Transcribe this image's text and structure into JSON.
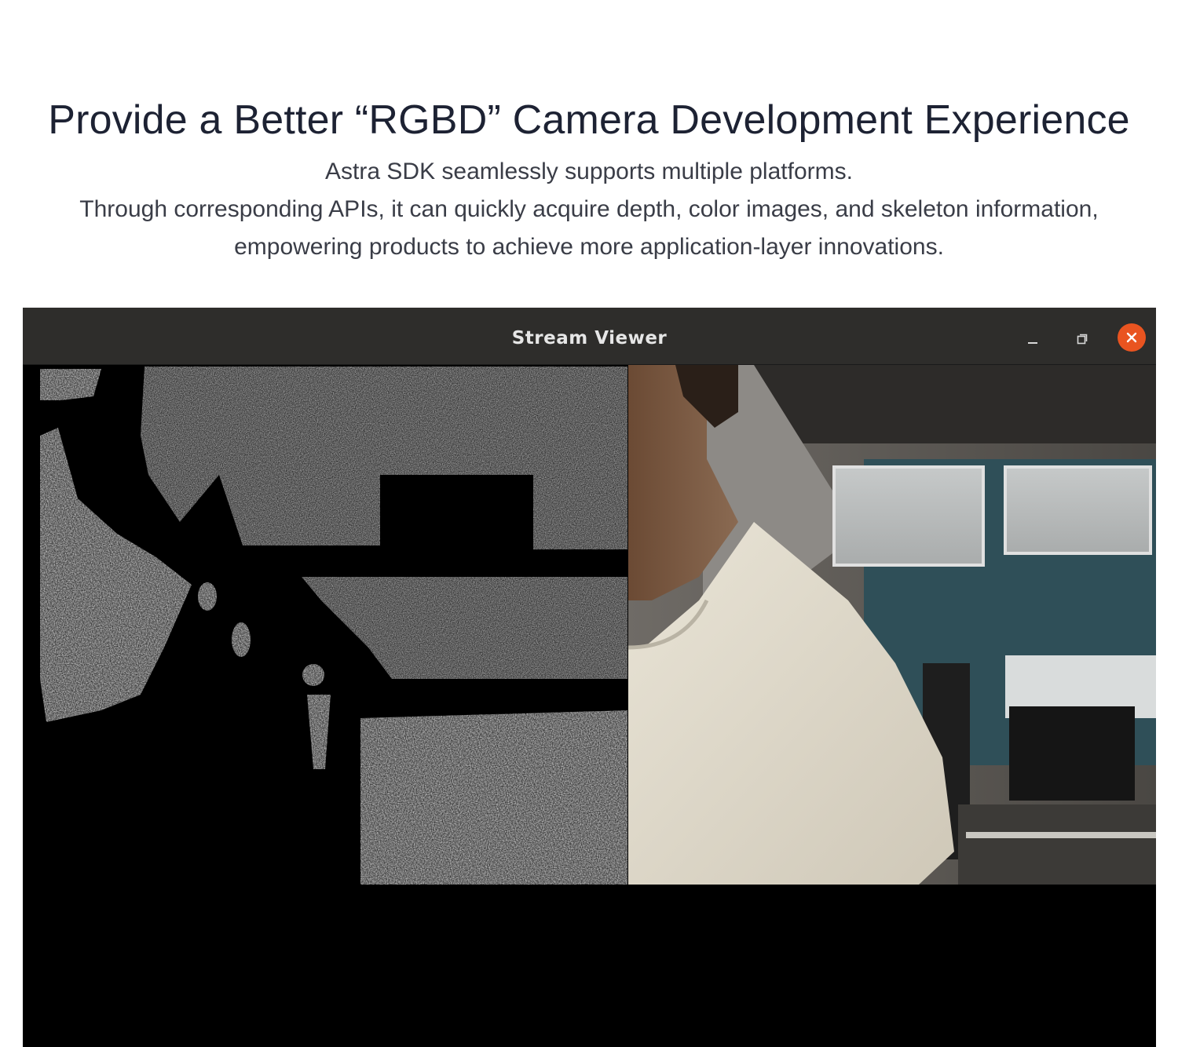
{
  "hero": {
    "headline": "Provide a Better “RGBD” Camera Development Experience",
    "line1": "Astra SDK seamlessly supports multiple platforms.",
    "line2": "Through corresponding APIs, it can quickly acquire depth, color images, and skeleton information,",
    "line3": "empowering products to achieve more application-layer innovations."
  },
  "window": {
    "title": "Stream Viewer",
    "controls": [
      "minimize-icon",
      "maximize-icon",
      "close-icon"
    ],
    "accent_color": "#e95420",
    "titlebar_color": "#2e2d2b"
  },
  "streams": {
    "depth": "depth-stream",
    "color": "color-stream"
  }
}
